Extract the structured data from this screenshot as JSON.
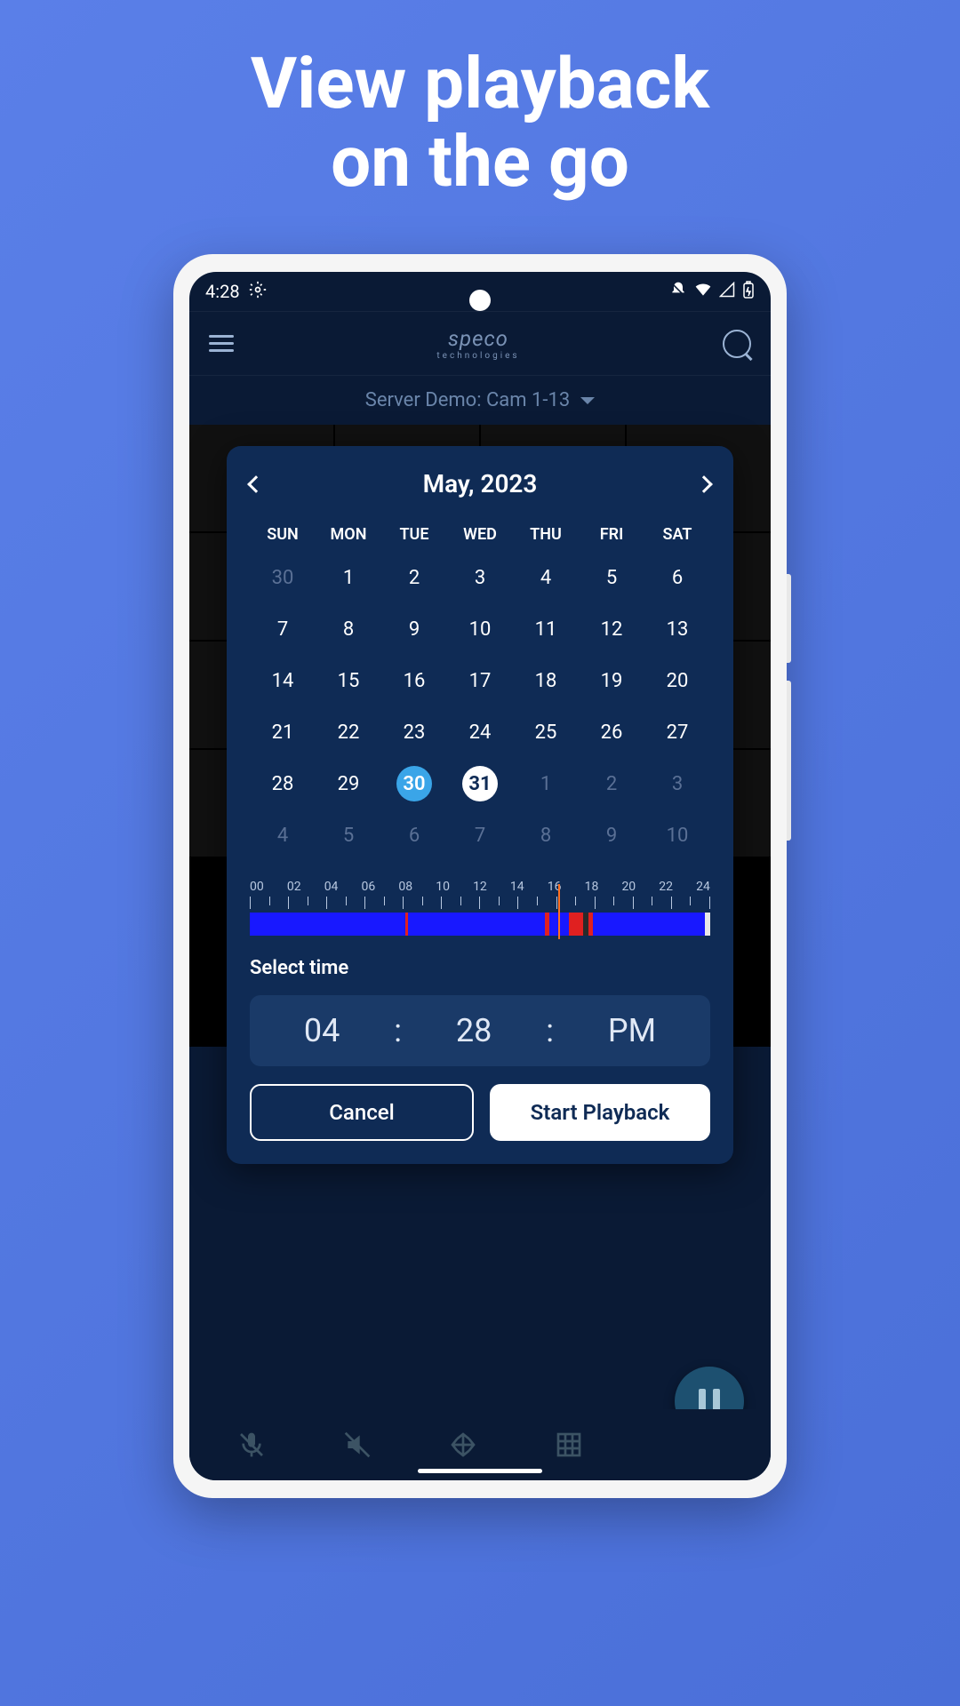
{
  "hero": {
    "line1": "View playback",
    "line2": "on the go"
  },
  "statusbar": {
    "time": "4:28"
  },
  "header": {
    "logo": "speco",
    "logo_sub": "technologies"
  },
  "selector": {
    "label": "Server Demo: Cam 1-13"
  },
  "modal": {
    "title": "May, 2023",
    "weekdays": [
      "SUN",
      "MON",
      "TUE",
      "WED",
      "THU",
      "FRI",
      "SAT"
    ],
    "days": [
      {
        "n": "30",
        "dim": true
      },
      {
        "n": "1"
      },
      {
        "n": "2"
      },
      {
        "n": "3"
      },
      {
        "n": "4"
      },
      {
        "n": "5"
      },
      {
        "n": "6"
      },
      {
        "n": "7"
      },
      {
        "n": "8"
      },
      {
        "n": "9"
      },
      {
        "n": "10"
      },
      {
        "n": "11"
      },
      {
        "n": "12"
      },
      {
        "n": "13"
      },
      {
        "n": "14"
      },
      {
        "n": "15"
      },
      {
        "n": "16"
      },
      {
        "n": "17"
      },
      {
        "n": "18"
      },
      {
        "n": "19"
      },
      {
        "n": "20"
      },
      {
        "n": "21"
      },
      {
        "n": "22"
      },
      {
        "n": "23"
      },
      {
        "n": "24"
      },
      {
        "n": "25"
      },
      {
        "n": "26"
      },
      {
        "n": "27"
      },
      {
        "n": "28"
      },
      {
        "n": "29"
      },
      {
        "n": "30",
        "selected": true
      },
      {
        "n": "31",
        "today": true
      },
      {
        "n": "1",
        "dim": true
      },
      {
        "n": "2",
        "dim": true
      },
      {
        "n": "3",
        "dim": true
      },
      {
        "n": "4",
        "dim": true
      },
      {
        "n": "5",
        "dim": true
      },
      {
        "n": "6",
        "dim": true
      },
      {
        "n": "7",
        "dim": true
      },
      {
        "n": "8",
        "dim": true
      },
      {
        "n": "9",
        "dim": true
      },
      {
        "n": "10",
        "dim": true
      }
    ],
    "timeline_hours": [
      "00",
      "02",
      "04",
      "06",
      "08",
      "10",
      "12",
      "14",
      "16",
      "18",
      "20",
      "22",
      "24"
    ],
    "select_time_label": "Select time",
    "time": {
      "hour": "04",
      "sep1": ":",
      "minute": "28",
      "sep2": ":",
      "ampm": "PM"
    },
    "cancel": "Cancel",
    "start": "Start Playback"
  }
}
